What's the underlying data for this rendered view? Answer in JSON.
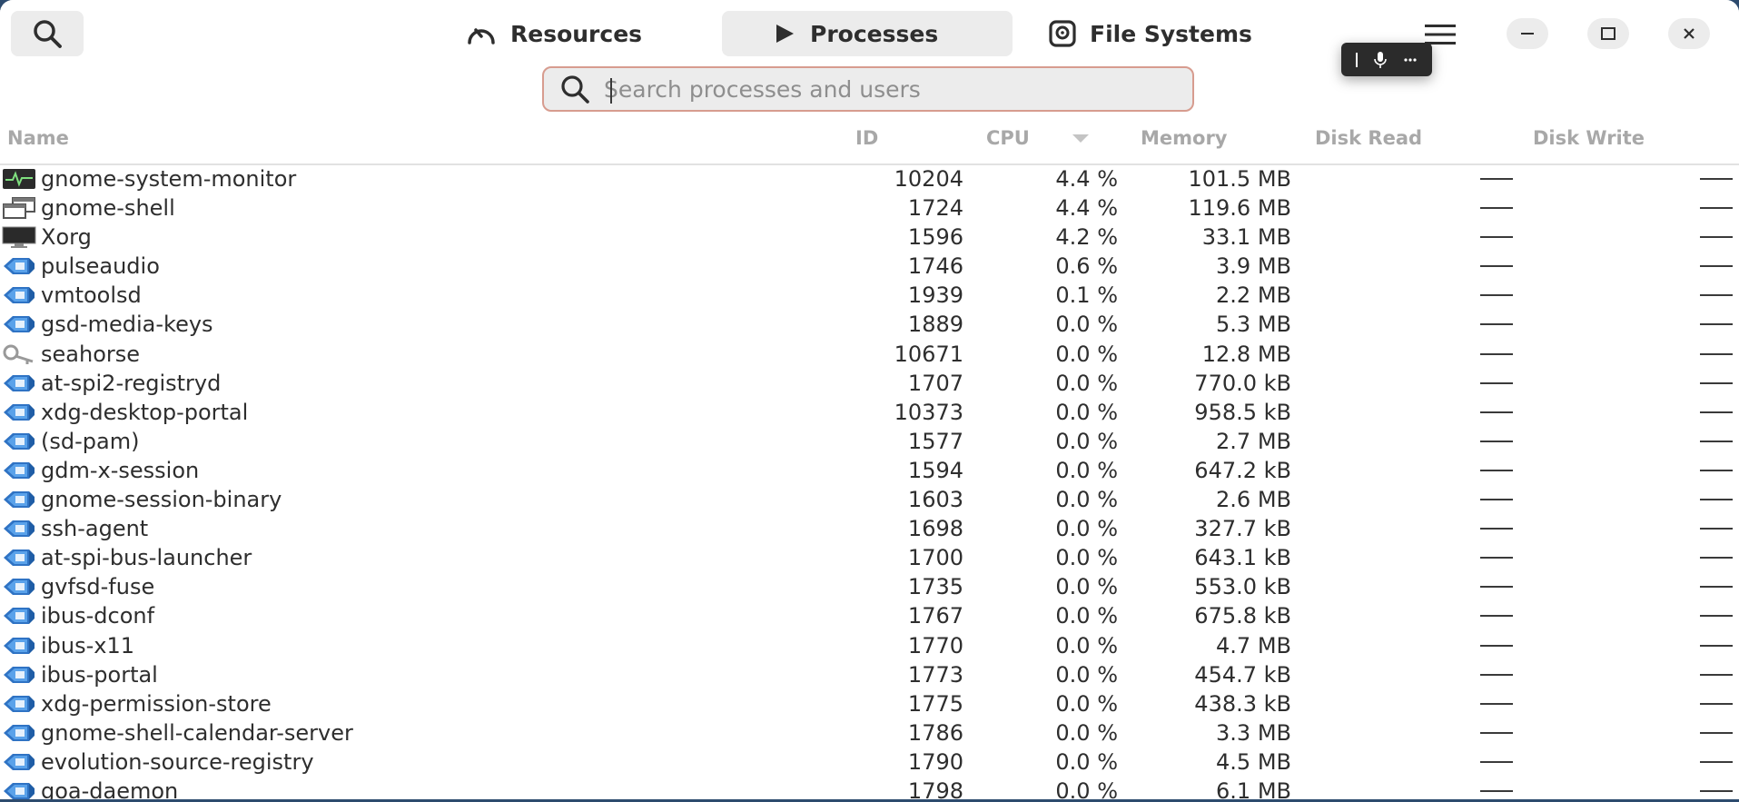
{
  "header": {
    "tabs": [
      {
        "label": "Resources",
        "icon": "gauge-icon"
      },
      {
        "label": "Processes",
        "icon": "play-icon",
        "active": true
      },
      {
        "label": "File Systems",
        "icon": "disk-icon"
      }
    ]
  },
  "search": {
    "placeholder": "Search processes and users",
    "value": ""
  },
  "columns": {
    "name": "Name",
    "id": "ID",
    "cpu": "CPU",
    "memory": "Memory",
    "disk_read": "Disk Read",
    "disk_write": "Disk Write"
  },
  "processes": [
    {
      "name": "gnome-system-monitor",
      "id": "10204",
      "cpu": "4.4 %",
      "memory": "101.5 MB",
      "disk_read": "—",
      "disk_write": "—",
      "icon": "system-monitor-icon"
    },
    {
      "name": "gnome-shell",
      "id": "1724",
      "cpu": "4.4 %",
      "memory": "119.6 MB",
      "disk_read": "—",
      "disk_write": "—",
      "icon": "windows-icon"
    },
    {
      "name": "Xorg",
      "id": "1596",
      "cpu": "4.2 %",
      "memory": "33.1 MB",
      "disk_read": "—",
      "disk_write": "—",
      "icon": "monitor-icon"
    },
    {
      "name": "pulseaudio",
      "id": "1746",
      "cpu": "0.6 %",
      "memory": "3.9 MB",
      "disk_read": "—",
      "disk_write": "—",
      "icon": "executable-icon"
    },
    {
      "name": "vmtoolsd",
      "id": "1939",
      "cpu": "0.1 %",
      "memory": "2.2 MB",
      "disk_read": "—",
      "disk_write": "—",
      "icon": "executable-icon"
    },
    {
      "name": "gsd-media-keys",
      "id": "1889",
      "cpu": "0.0 %",
      "memory": "5.3 MB",
      "disk_read": "—",
      "disk_write": "—",
      "icon": "executable-icon"
    },
    {
      "name": "seahorse",
      "id": "10671",
      "cpu": "0.0 %",
      "memory": "12.8 MB",
      "disk_read": "—",
      "disk_write": "—",
      "icon": "key-icon"
    },
    {
      "name": "at-spi2-registryd",
      "id": "1707",
      "cpu": "0.0 %",
      "memory": "770.0 kB",
      "disk_read": "—",
      "disk_write": "—",
      "icon": "executable-icon"
    },
    {
      "name": "xdg-desktop-portal",
      "id": "10373",
      "cpu": "0.0 %",
      "memory": "958.5 kB",
      "disk_read": "—",
      "disk_write": "—",
      "icon": "executable-icon"
    },
    {
      "name": "(sd-pam)",
      "id": "1577",
      "cpu": "0.0 %",
      "memory": "2.7 MB",
      "disk_read": "—",
      "disk_write": "—",
      "icon": "executable-icon"
    },
    {
      "name": "gdm-x-session",
      "id": "1594",
      "cpu": "0.0 %",
      "memory": "647.2 kB",
      "disk_read": "—",
      "disk_write": "—",
      "icon": "executable-icon"
    },
    {
      "name": "gnome-session-binary",
      "id": "1603",
      "cpu": "0.0 %",
      "memory": "2.6 MB",
      "disk_read": "—",
      "disk_write": "—",
      "icon": "executable-icon"
    },
    {
      "name": "ssh-agent",
      "id": "1698",
      "cpu": "0.0 %",
      "memory": "327.7 kB",
      "disk_read": "—",
      "disk_write": "—",
      "icon": "executable-icon"
    },
    {
      "name": "at-spi-bus-launcher",
      "id": "1700",
      "cpu": "0.0 %",
      "memory": "643.1 kB",
      "disk_read": "—",
      "disk_write": "—",
      "icon": "executable-icon"
    },
    {
      "name": "gvfsd-fuse",
      "id": "1735",
      "cpu": "0.0 %",
      "memory": "553.0 kB",
      "disk_read": "—",
      "disk_write": "—",
      "icon": "executable-icon"
    },
    {
      "name": "ibus-dconf",
      "id": "1767",
      "cpu": "0.0 %",
      "memory": "675.8 kB",
      "disk_read": "—",
      "disk_write": "—",
      "icon": "executable-icon"
    },
    {
      "name": "ibus-x11",
      "id": "1770",
      "cpu": "0.0 %",
      "memory": "4.7 MB",
      "disk_read": "—",
      "disk_write": "—",
      "icon": "executable-icon"
    },
    {
      "name": "ibus-portal",
      "id": "1773",
      "cpu": "0.0 %",
      "memory": "454.7 kB",
      "disk_read": "—",
      "disk_write": "—",
      "icon": "executable-icon"
    },
    {
      "name": "xdg-permission-store",
      "id": "1775",
      "cpu": "0.0 %",
      "memory": "438.3 kB",
      "disk_read": "—",
      "disk_write": "—",
      "icon": "executable-icon"
    },
    {
      "name": "gnome-shell-calendar-server",
      "id": "1786",
      "cpu": "0.0 %",
      "memory": "3.3 MB",
      "disk_read": "—",
      "disk_write": "—",
      "icon": "executable-icon"
    },
    {
      "name": "evolution-source-registry",
      "id": "1790",
      "cpu": "0.0 %",
      "memory": "4.5 MB",
      "disk_read": "—",
      "disk_write": "—",
      "icon": "executable-icon"
    },
    {
      "name": "goa-daemon",
      "id": "1798",
      "cpu": "0.0 %",
      "memory": "6.1 MB",
      "disk_read": "—",
      "disk_write": "—",
      "icon": "executable-icon"
    }
  ],
  "colors": {
    "accent_border": "#d79c8f",
    "exec_icon_blue": "#3f86d6",
    "window_bg": "#ffffff",
    "button_bg": "#ececec"
  }
}
